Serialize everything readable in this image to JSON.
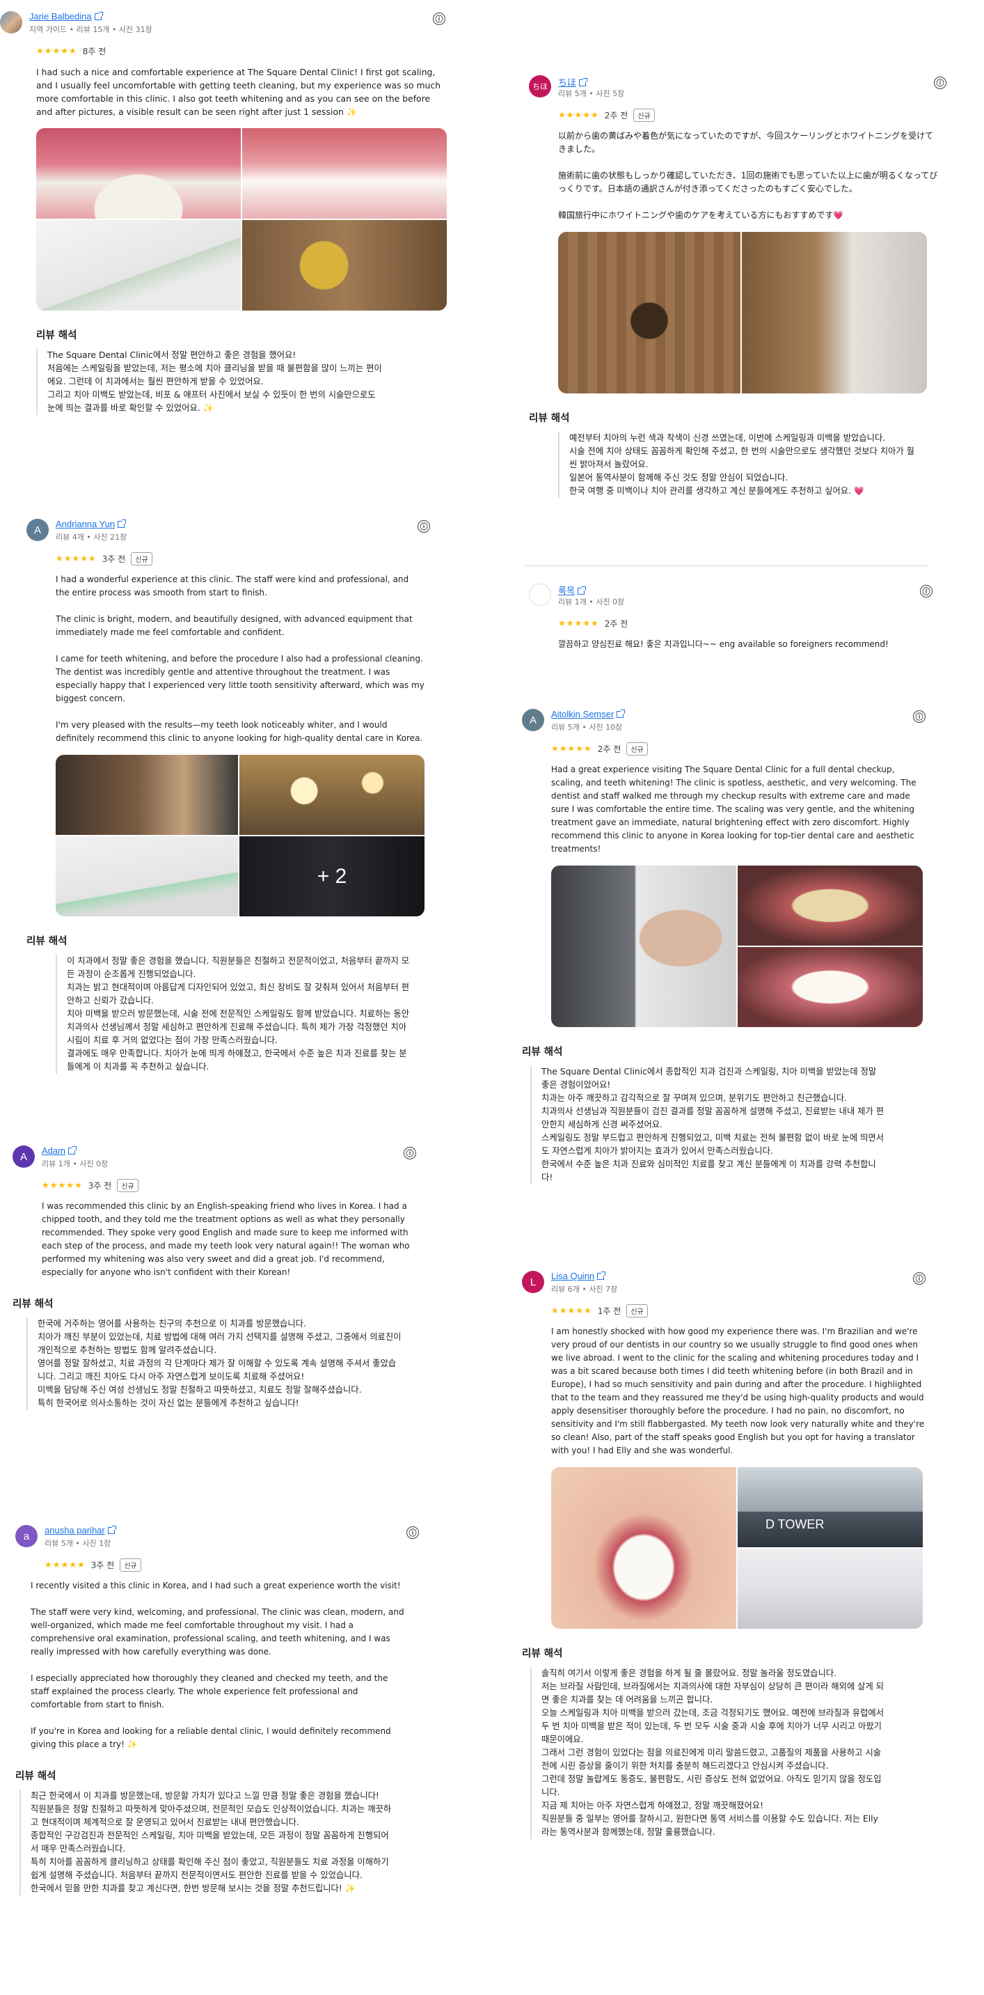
{
  "reviews": [
    {
      "id": "r1",
      "user": "Jarie Balbedina",
      "meta": "지역 가이드 • 리뷰 15개 • 사진 31장",
      "stars": "★★★★★",
      "date": "8주 전",
      "text": "I had such a nice and comfortable experience at The Square Dental Clinic! I first got scaling, and I usually feel uncomfortable with getting teeth cleaning, but my experience was so much more comfortable in this clinic. I also got teeth whitening and as you can see on the before and after pictures, a visible result can be seen right after just 1 session ✨",
      "translation_title": "리뷰 해석",
      "translation": "The Square Dental Clinic에서 정말 편안하고 좋은 경험을 했어요!\n처음에는 스케일링을 받았는데, 저는 평소에 치아 클리닝을 받을 때 불편함을 많이 느끼는 편이에요. 그런데 이 치과에서는 훨씬 편안하게 받을 수 있었어요.\n그리고 치아 미백도 받았는데, 비포 & 애프터 사진에서 보실 수 있듯이 한 번의 시술만으로도 눈에 띄는 결과를 바로 확인할 수 있었어요. ✨"
    },
    {
      "id": "r2",
      "user": "ちほ",
      "avatar": "ちほ",
      "meta": "리뷰 5개 • 사진 5장",
      "stars": "★★★★★",
      "date": "2주 전",
      "badge": "신규",
      "text": "以前から歯の黄ばみや着色が気になっていたのですが、今回スケーリングとホワイトニングを受けてきました。\n\n施術前に歯の状態もしっかり確認していただき、1回の施術でも思っていた以上に歯が明るくなってびっくりです。日本語の通訳さんが付き添ってくださったのもすごく安心でした。\n\n韓国旅行中にホワイトニングや歯のケアを考えている方にもおすすめです💗",
      "translation_title": "리뷰 해석",
      "translation": "예전부터 치아의 누런 색과 착색이 신경 쓰였는데, 이번에 스케일링과 미백을 받았습니다.\n시술 전에 치아 상태도 꼼꼼하게 확인해 주셨고, 한 번의 시술만으로도 생각했던 것보다 치아가 훨씬 밝아져서 놀랐어요.\n일본어 통역사분이 함께해 주신 것도 정말 안심이 되었습니다.\n한국 여행 중 미백이나 치아 관리를 생각하고 계신 분들에게도 추천하고 싶어요. 💗"
    },
    {
      "id": "r3",
      "user": "Andrianna Yun",
      "avatar": "A",
      "meta": "리뷰 4개 • 사진 21장",
      "stars": "★★★★★",
      "date": "3주 전",
      "badge": "신규",
      "text": "I had a wonderful experience at this clinic. The staff were kind and professional, and the entire process was smooth from start to finish.\n\nThe clinic is bright, modern, and beautifully designed, with advanced equipment that immediately made me feel comfortable and confident.\n\nI came for teeth whitening, and before the procedure I also had a professional cleaning. The dentist was incredibly gentle and attentive throughout the treatment. I was especially happy that I experienced very little tooth sensitivity afterward, which was my biggest concern.\n\nI'm very pleased with the results—my teeth look noticeably whiter, and I would definitely recommend this clinic to anyone looking for high-quality dental care in Korea.",
      "more_photos": "+ 2",
      "translation_title": "리뷰 해석",
      "translation": "이 치과에서 정말 좋은 경험을 했습니다. 직원분들은 친절하고 전문적이었고, 처음부터 끝까지 모든 과정이 순조롭게 진행되었습니다.\n치과는 밝고 현대적이며 아름답게 디자인되어 있었고, 최신 장비도 잘 갖춰져 있어서 처음부터 편안하고 신뢰가 갔습니다.\n치아 미백을 받으러 방문했는데, 시술 전에 전문적인 스케일링도 함께 받았습니다. 치료하는 동안 치과의사 선생님께서 정말 세심하고 편안하게 진료해 주셨습니다. 특히 제가 가장 걱정했던 치아 시림이 치료 후 거의 없었다는 점이 가장 만족스러웠습니다.\n결과에도 매우 만족합니다. 치아가 눈에 띄게 하얘졌고, 한국에서 수준 높은 치과 진료를 찾는 분들에게 이 치과를 꼭 추천하고 싶습니다."
    },
    {
      "id": "r4",
      "user": "록목",
      "meta": "리뷰 1개 • 사진 0장",
      "stars": "★★★★★",
      "date": "2주 전",
      "text": "깔끔하고 양심진료 해요! 좋은 치과입니다~~ eng available so foreigners recommend!"
    },
    {
      "id": "r5",
      "user": "Aitolkin Semser",
      "avatar": "A",
      "meta": "리뷰 5개 • 사진 10장",
      "stars": "★★★★★",
      "date": "2주 전",
      "badge": "신규",
      "text": "Had a great experience visiting The Square Dental Clinic for a full dental checkup, scaling, and teeth whitening! The clinic is spotless, aesthetic, and very welcoming. The dentist and staff walked me through my checkup results with extreme care and made sure I was comfortable the entire time. The scaling was very gentle, and the whitening treatment gave an immediate, natural brightening effect with zero discomfort. Highly recommend this clinic to anyone in Korea looking for top-tier dental care and aesthetic treatments!",
      "translation_title": "리뷰 해석",
      "translation": "The Square Dental Clinic에서 종합적인 치과 검진과 스케일링, 치아 미백을 받았는데 정말 좋은 경험이었어요!\n치과는 아주 깨끗하고 감각적으로 잘 꾸며져 있으며, 분위기도 편안하고 친근했습니다.\n치과의사 선생님과 직원분들이 검진 결과를 정말 꼼꼼하게 설명해 주셨고, 진료받는 내내 제가 편안한지 세심하게 신경 써주셨어요.\n스케일링도 정말 부드럽고 편안하게 진행되었고, 미백 치료는 전혀 불편함 없이 바로 눈에 띄면서도 자연스럽게 치아가 밝아지는 효과가 있어서 만족스러웠습니다.\n한국에서 수준 높은 치과 진료와 심미적인 치료를 찾고 계신 분들에게 이 치과를 강력 추천합니다!"
    },
    {
      "id": "r6",
      "user": "Adam",
      "avatar": "A",
      "meta": "리뷰 1개 • 사진 0장",
      "stars": "★★★★★",
      "date": "3주 전",
      "badge": "신규",
      "text": "I was recommended this clinic by an English-speaking friend who lives in Korea. I had a chipped tooth, and they told me the treatment options as well as what they personally recommended. They spoke very good English and made sure to keep me informed with each step of the process, and made my teeth look very natural again!! The woman who performed my whitening was also very sweet and did a great job. I'd recommend, especially for anyone who isn't confident with their Korean!",
      "translation_title": "리뷰 해석",
      "translation": "한국에 거주하는 영어를 사용하는 친구의 추천으로 이 치과를 방문했습니다.\n치아가 깨진 부분이 있었는데, 치료 방법에 대해 여러 가지 선택지를 설명해 주셨고, 그중에서 의료진이 개인적으로 추천하는 방법도 함께 알려주셨습니다.\n영어를 정말 잘하셨고, 치료 과정의 각 단계마다 제가 잘 이해할 수 있도록 계속 설명해 주셔서 좋았습니다. 그리고 깨진 치아도 다시 아주 자연스럽게 보이도록 치료해 주셨어요!\n미백을 담당해 주신 여성 선생님도 정말 친절하고 따뜻하셨고, 치료도 정말 잘해주셨습니다.\n특히 한국어로 의사소통하는 것이 자신 없는 분들에게 추천하고 싶습니다!"
    },
    {
      "id": "r7",
      "user": "Lisa Quinn",
      "avatar": "L",
      "meta": "리뷰 6개 • 사진 7장",
      "stars": "★★★★★",
      "date": "1주 전",
      "badge": "신규",
      "text": "I am honestly shocked with how good my experience there was. I'm Brazilian and we're very proud of our dentists in our country so we usually struggle to find good ones when we live abroad. I went to the clinic for the scaling and whitening procedures today and I was a bit scared because both times I did teeth whitening before (in both Brazil and in Europe), I had so much sensitivity and pain during and after the procedure. I highlighted that to the team and they reassured me they'd be using high-quality products and would apply desensitiser thoroughly before the procedure. I had no pain, no discomfort, no sensitivity and I'm still flabbergasted. My teeth now look very naturally white and they're so clean! Also, part of the staff speaks good English but you opt for having a translator with you! I had Elly and she was wonderful.",
      "photo_sign": "D TOWER",
      "translation_title": "리뷰 해석",
      "translation": "솔직히 여기서 이렇게 좋은 경험을 하게 될 줄 몰랐어요. 정말 놀라울 정도였습니다.\n저는 브라질 사람인데, 브라질에서는 치과의사에 대한 자부심이 상당히 큰 편이라 해외에 살게 되면 좋은 치과를 찾는 데 어려움을 느끼곤 합니다.\n오늘 스케일링과 치아 미백을 받으러 갔는데, 조금 걱정되기도 했어요. 예전에 브라질과 유럽에서 두 번 치아 미백을 받은 적이 있는데, 두 번 모두 시술 중과 시술 후에 치아가 너무 시리고 아팠기 때문이에요.\n그래서 그런 경험이 있었다는 점을 의료진에게 미리 말씀드렸고, 고품질의 제품을 사용하고 시술 전에 시린 증상을 줄이기 위한 처치를 충분히 해드리겠다고 안심시켜 주셨습니다.\n그런데 정말 놀랍게도 통증도, 불편함도, 시린 증상도 전혀 없었어요. 아직도 믿기지 않을 정도입니다.\n지금 제 치아는 아주 자연스럽게 하얘졌고, 정말 깨끗해졌어요!\n직원분들 중 일부는 영어를 잘하시고, 원한다면 통역 서비스를 이용할 수도 있습니다. 저는 Elly라는 통역사분과 함께했는데, 정말 훌륭했습니다."
    },
    {
      "id": "r8",
      "user": "anusha parihar",
      "avatar": "a",
      "meta": "리뷰 5개 • 사진 1장",
      "stars": "★★★★★",
      "date": "3주 전",
      "badge": "신규",
      "text": "I recently visited a this clinic in Korea, and I had such a great experience worth the visit!\n\nThe staff were very kind, welcoming, and professional. The clinic was clean, modern, and well-organized, which made me feel comfortable throughout my visit. I had a comprehensive oral examination, professional scaling, and teeth whitening, and I was really impressed with how carefully everything was done.\n\nI especially appreciated how thoroughly they cleaned and checked my teeth, and the staff explained the process clearly. The whole experience felt professional and comfortable from start to finish.\n\nIf you're in Korea and looking for a reliable dental clinic, I would definitely recommend giving this place a try! ✨",
      "translation_title": "리뷰 해석",
      "translation": "최근 한국에서 이 치과를 방문했는데, 방문할 가치가 있다고 느낄 만큼 정말 좋은 경험을 했습니다!\n직원분들은 정말 친절하고 따뜻하게 맞아주셨으며, 전문적인 모습도 인상적이었습니다. 치과는 깨끗하고 현대적이며 체계적으로 잘 운영되고 있어서 진료받는 내내 편안했습니다.\n종합적인 구강검진과 전문적인 스케일링, 치아 미백을 받았는데, 모든 과정이 정말 꼼꼼하게 진행되어서 매우 만족스러웠습니다.\n특히 치아를 꼼꼼하게 클리닝하고 상태를 확인해 주신 점이 좋았고, 직원분들도 치료 과정을 이해하기 쉽게 설명해 주셨습니다. 처음부터 끝까지 전문적이면서도 편안한 진료를 받을 수 있었습니다.\n한국에서 믿을 만한 치과를 찾고 계신다면, 한번 방문해 보시는 것을 정말 추천드립니다! ✨"
    }
  ],
  "info_icon": "ⓘ",
  "colors": {
    "star": "#fbbc04",
    "link": "#1a73e8",
    "avatar_chiho": "#c2185b",
    "avatar_andrianna": "#5f7d95",
    "avatar_aitolkin": "#607d8b",
    "avatar_adam": "#5e35b1",
    "avatar_lisa": "#c2185b",
    "avatar_anusha": "#7e57c2"
  }
}
